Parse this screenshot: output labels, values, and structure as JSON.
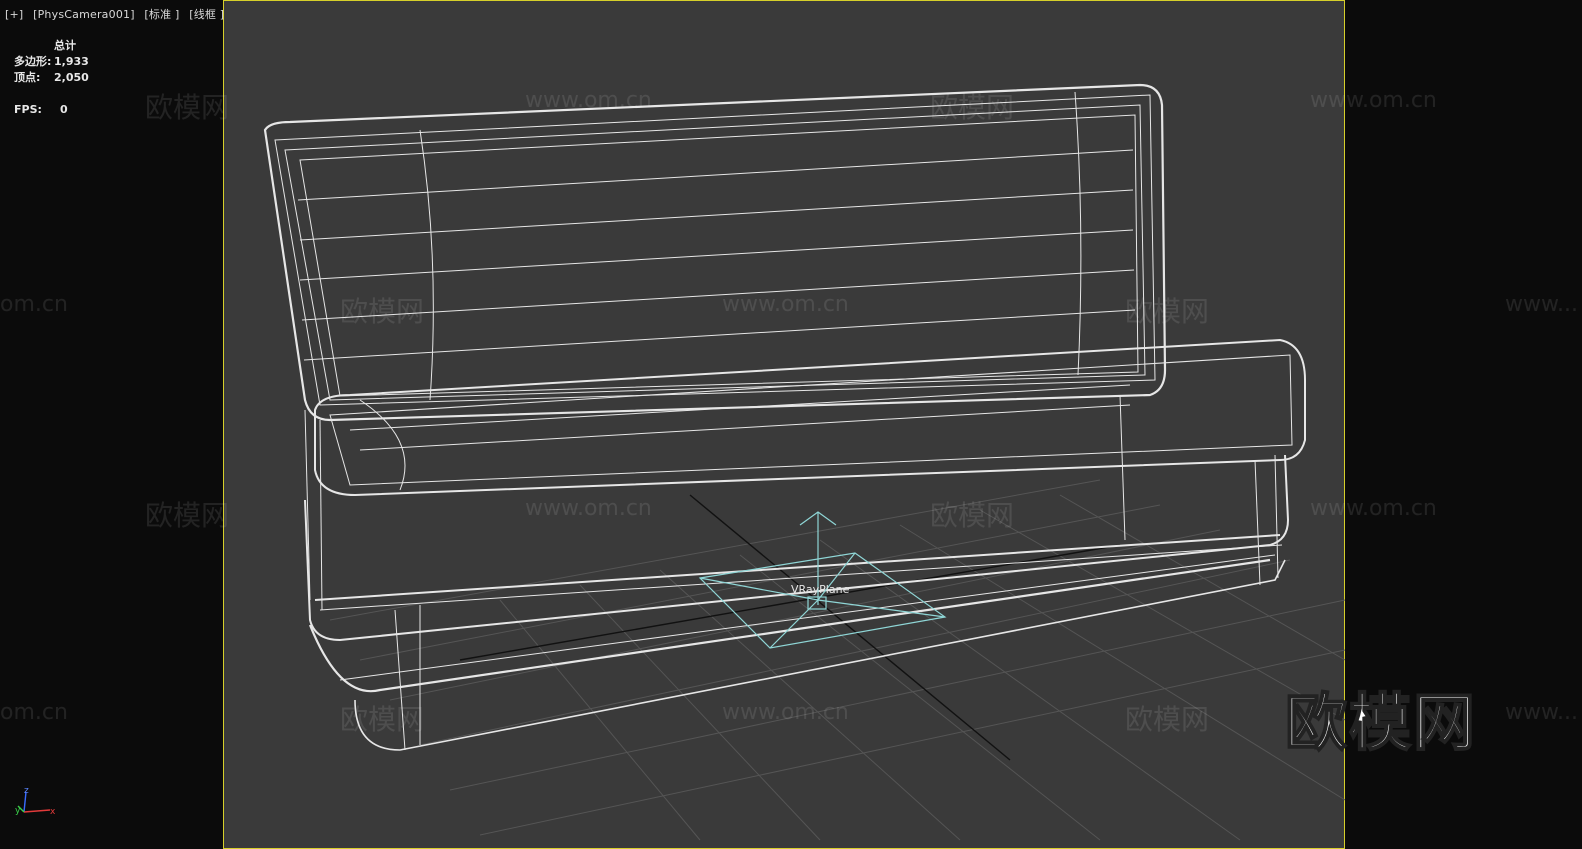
{
  "viewport": {
    "label_parts": [
      "[+]",
      "[PhysCamera001]",
      "[标准 ]",
      "[线框 ]"
    ]
  },
  "stats": {
    "total_label": "总计",
    "polys_label": "多边形:",
    "polys_value": "1,933",
    "verts_label": "顶点:",
    "verts_value": "2,050",
    "fps_label": "FPS:",
    "fps_value": "0"
  },
  "scene": {
    "object_label": "VRayPlane",
    "wire_color": "#e6e6e6",
    "light_color": "#8fd6d6",
    "frame_color": "#d6cf2a",
    "grid_color": "#5a5a5a"
  },
  "watermarks": {
    "site": "www.om.cn",
    "site_short": "om.cn",
    "site_partial": "www...",
    "brand": "欧模网",
    "brand_big": "欧模网"
  },
  "gizmo": {
    "z": "z",
    "x": "x",
    "y": "y"
  }
}
